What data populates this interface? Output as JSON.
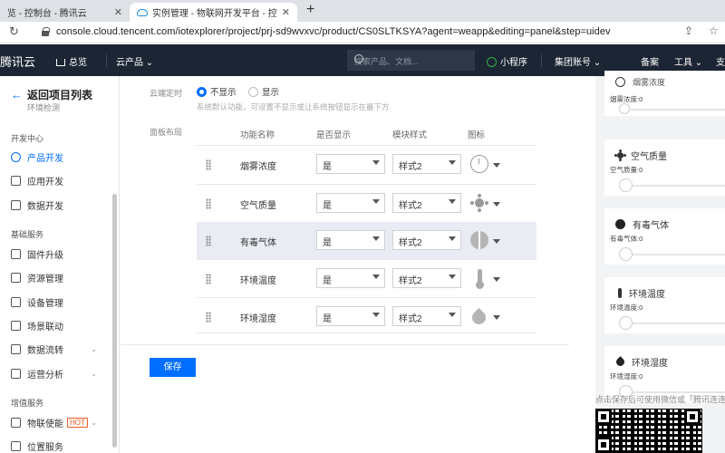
{
  "browser": {
    "tabs": [
      {
        "title": "览 - 控制台 - 腾讯云"
      },
      {
        "title": "实例管理 - 物联网开发平台 - 控"
      }
    ],
    "url": "console.cloud.tencent.com/iotexplorer/project/prj-sd9wvxvc/product/CS0SLTKSYA?agent=weapp&editing=panel&step=uidev"
  },
  "topnav": {
    "logo": "腾讯云",
    "home": "总览",
    "products": "云产品",
    "search_placeholder": "搜索产品、文档...",
    "mini_program": "小程序",
    "group_account": "集团账号",
    "filing": "备案",
    "tools": "工具",
    "support": "支"
  },
  "sidebar": {
    "back": "返回项目列表",
    "subtitle": "环境检测",
    "group1": "开发中心",
    "items1": [
      "产品开发",
      "应用开发",
      "数据开发"
    ],
    "group2": "基础服务",
    "items2": [
      "固件升级",
      "资源管理",
      "设备管理",
      "场景联动",
      "数据流转",
      "运营分析"
    ],
    "group3": "增值服务",
    "items3": [
      "物联使能",
      "位置服务"
    ],
    "hot": "HOT"
  },
  "main": {
    "cloud_timer_label": "云端定时",
    "radio_hide": "不显示",
    "radio_show": "显示",
    "hint": "系统默认功能，可设置不显示或让系统按钮显示在最下方",
    "panel_layout_label": "面板布局",
    "columns": [
      "功能名称",
      "是否显示",
      "模块样式",
      "图标"
    ],
    "rows": [
      {
        "name": "烟雾浓度",
        "show": "是",
        "style": "样式2",
        "icon": "clock-icon"
      },
      {
        "name": "空气质量",
        "show": "是",
        "style": "样式2",
        "icon": "sun-icon"
      },
      {
        "name": "有毒气体",
        "show": "是",
        "style": "样式2",
        "icon": "ball-icon"
      },
      {
        "name": "环境温度",
        "show": "是",
        "style": "样式2",
        "icon": "thermometer-icon"
      },
      {
        "name": "环境湿度",
        "show": "是",
        "style": "样式2",
        "icon": "drop-icon"
      }
    ],
    "save": "保存"
  },
  "preview": {
    "top_partial": "烟雾浓度",
    "cards": [
      {
        "title": "烟雾浓度",
        "value": "烟雾浓度:0",
        "icon": "ring-icon"
      },
      {
        "title": "空气质量",
        "value": "空气质量:0",
        "icon": "sun-icon"
      },
      {
        "title": "有毒气体",
        "value": "有毒气体:0",
        "icon": "ball-icon"
      },
      {
        "title": "环境温度",
        "value": "环境温度:0",
        "icon": "thermometer-icon"
      },
      {
        "title": "环境湿度",
        "value": "环境湿度:0",
        "icon": "drop-icon"
      }
    ],
    "note": "点击保存后可使用微信或「腾讯连连」",
    "accent": "#006eff"
  }
}
